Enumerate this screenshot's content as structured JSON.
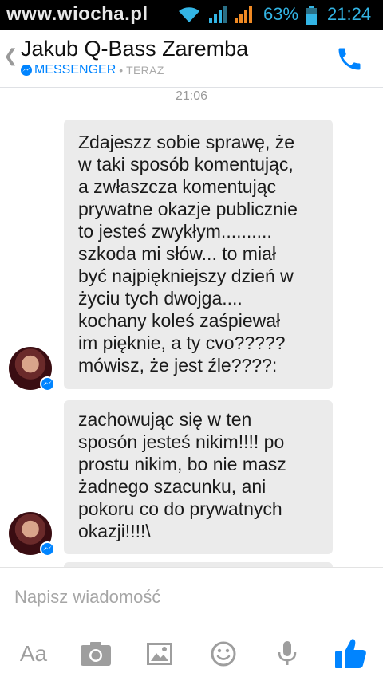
{
  "status_bar": {
    "watermark": "www.wiocha.pl",
    "battery_percent": "63%",
    "time": "21:24"
  },
  "header": {
    "contact_name": "Jakub Q-Bass Zaremba",
    "source_label": "MESSENGER",
    "separator": "•",
    "status_time": "TERAZ"
  },
  "chat": {
    "timestamp": "21:06",
    "messages": [
      {
        "text": "Zdajeszz sobie sprawę, że\nw taki sposób komentując,\na zwłaszcza komentując\nprywatne okazje publicznie\nto jesteś zwykłym..........\nszkoda mi słów... to miał\nbyć najpiękniejszy dzień w\nżyciu tych dwojga....\nkochany koleś zaśpiewał\nim pięknie, a ty cvo?????\nmówisz, że jest źle????:"
      },
      {
        "text": "zachowując się w ten\nsposón jesteś nikim!!!! po\nprostu nikim, bo nie masz\nżadnego szacunku, ani\npokoru co do prywatnych\nokazji!!!!\\"
      }
    ]
  },
  "composer": {
    "placeholder": "Napisz wiadomość",
    "font_button": "Aa"
  },
  "colors": {
    "accent": "#0084ff",
    "status_accent": "#33b5e5",
    "bubble": "#ebebeb"
  },
  "icons": [
    "back-chevron-icon",
    "phone-icon",
    "messenger-icon",
    "wifi-icon",
    "signal-icon",
    "battery-icon",
    "camera-icon",
    "gallery-icon",
    "emoji-icon",
    "microphone-icon",
    "thumbs-up-icon"
  ]
}
